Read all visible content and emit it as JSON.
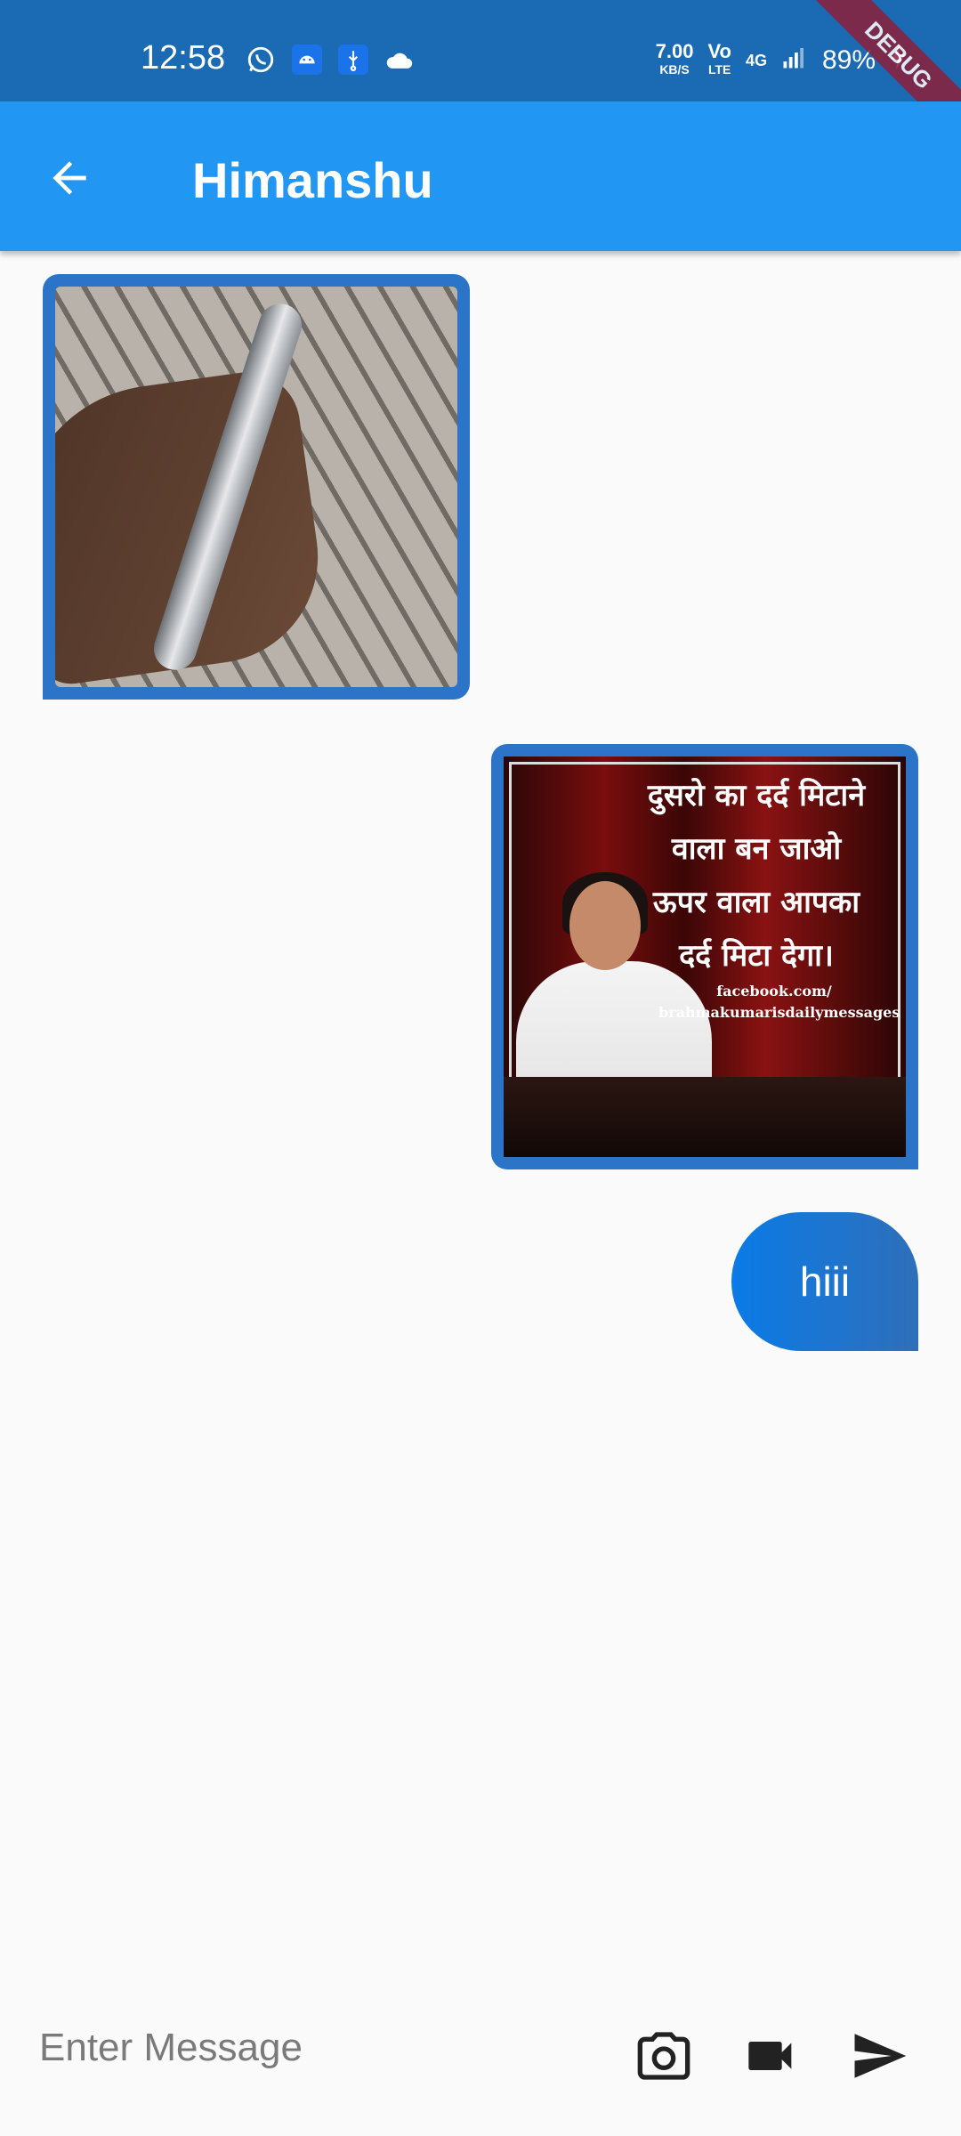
{
  "status_bar": {
    "time": "12:58",
    "net_speed": "7.00",
    "net_unit": "KB/S",
    "volte_top": "Vo",
    "volte_bottom": "LTE",
    "network": "4G",
    "battery": "89%",
    "debug_label": "DEBUG",
    "icons": [
      "whatsapp-icon",
      "android-icon",
      "usb-icon",
      "cloud-icon",
      "signal-icon",
      "charging-icon"
    ]
  },
  "app_bar": {
    "title": "Himanshu",
    "back_icon": "arrow-back-icon",
    "color": "#2196f3"
  },
  "messages": [
    {
      "type": "image",
      "side": "received",
      "content": "hand-holding-phone-photo"
    },
    {
      "type": "image",
      "side": "sent",
      "content": "quote-image",
      "quote_lines": [
        "दुसरो का दर्द मिटाने",
        "वाला बन जाओ",
        "ऊपर वाला आपका",
        "दर्द मिटा देगा।"
      ],
      "quote_url": [
        "facebook.com/",
        "brahmakumarisdailymessages"
      ]
    },
    {
      "type": "text",
      "side": "sent",
      "text": "hiii"
    }
  ],
  "input_bar": {
    "placeholder": "Enter Message",
    "value": "",
    "actions": [
      "camera-icon",
      "videocam-icon",
      "send-icon"
    ]
  },
  "colors": {
    "status_bar": "#1b6bb4",
    "bubble": "#2b74c8",
    "background": "#fafafa"
  }
}
